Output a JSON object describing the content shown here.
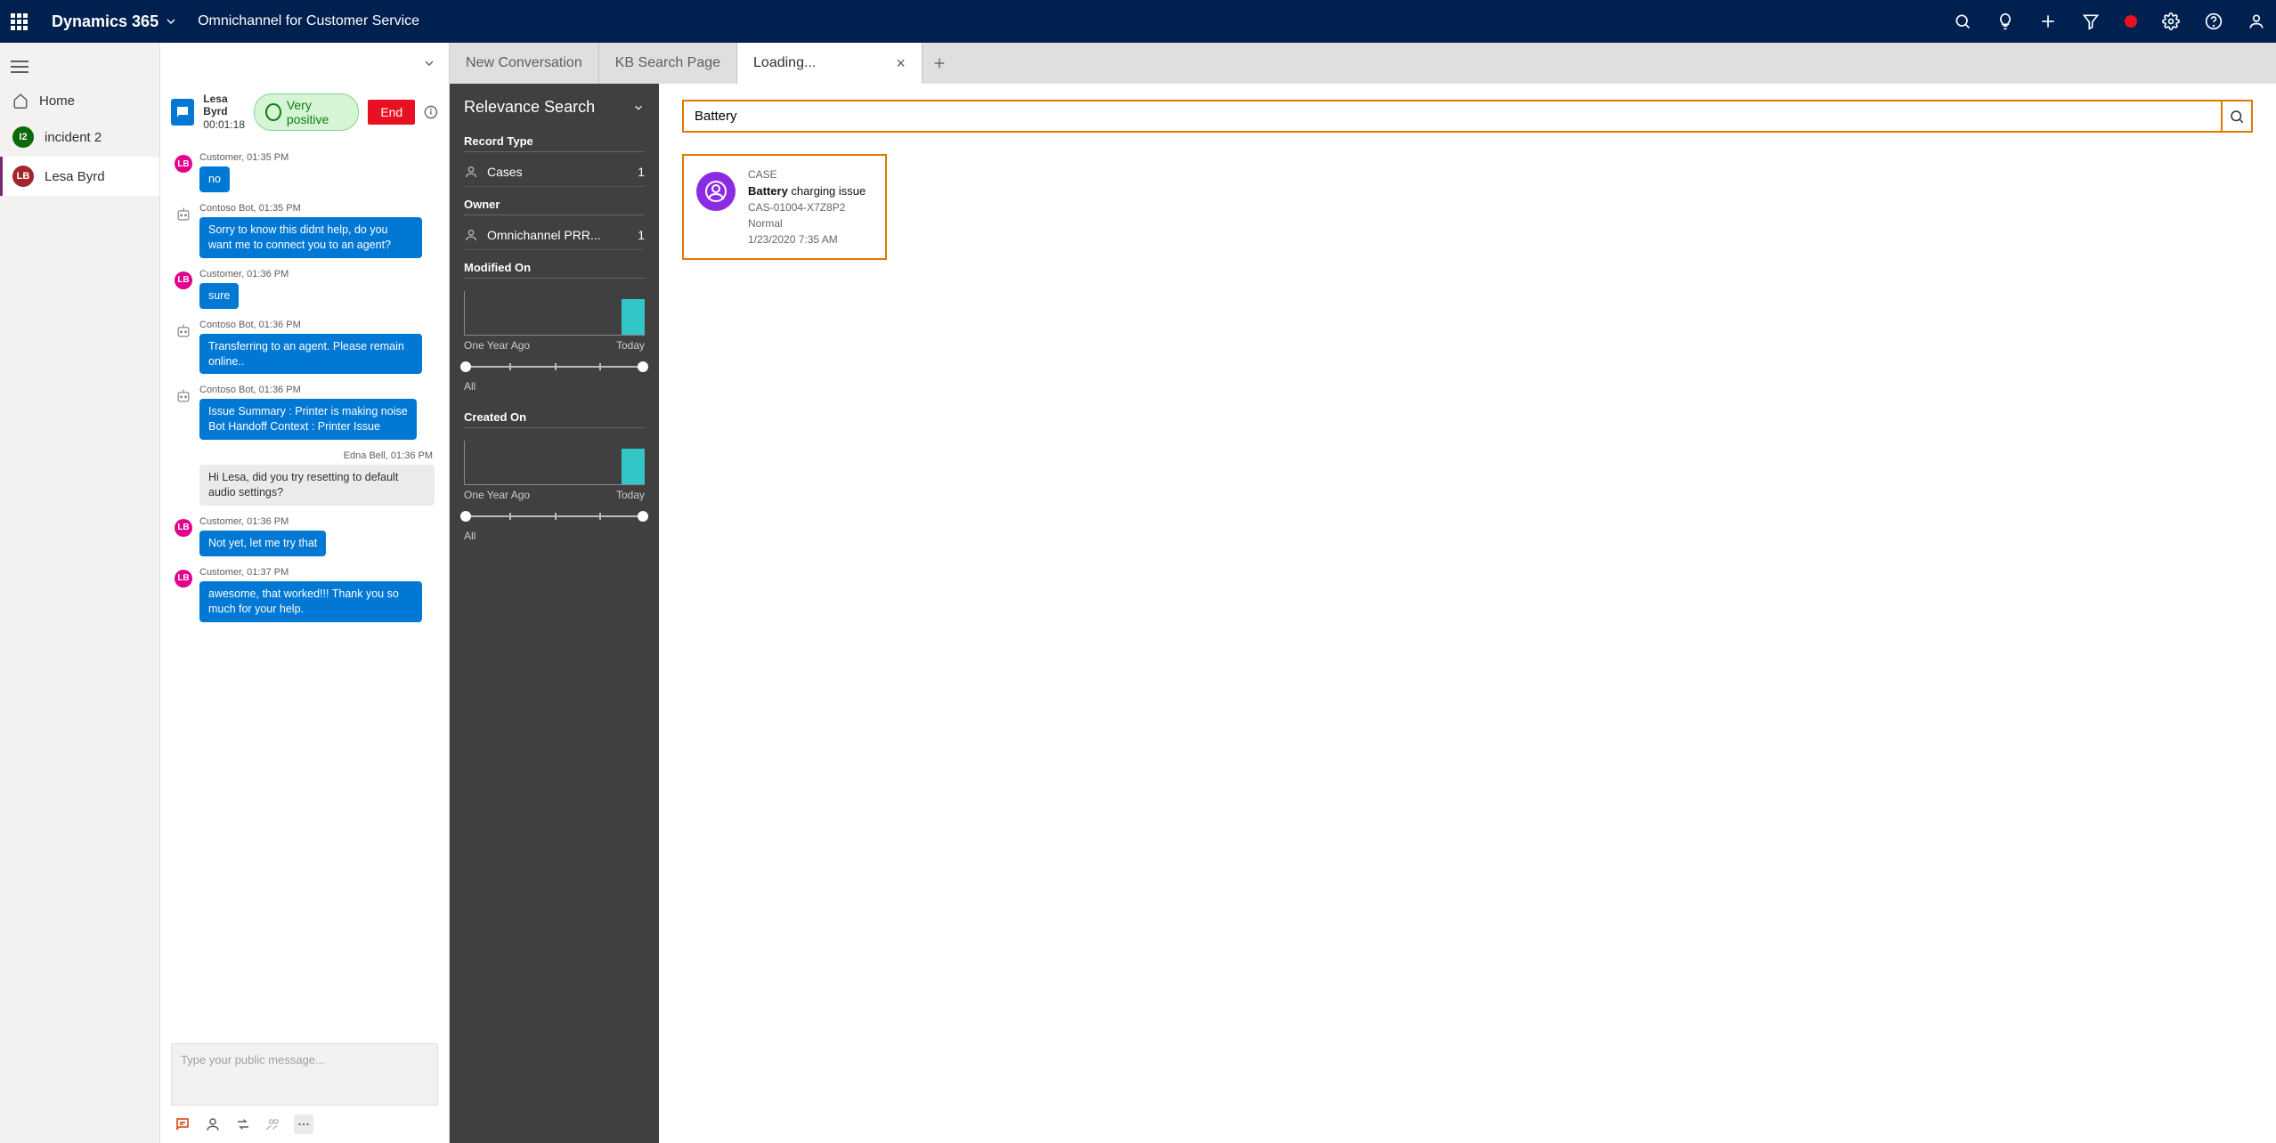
{
  "topbar": {
    "product": "Dynamics 365",
    "app": "Omnichannel for Customer Service"
  },
  "nav": {
    "home": "Home",
    "incident": {
      "badge": "I2",
      "badge_color": "#0b6a0b",
      "label": "incident 2"
    },
    "lesa": {
      "badge": "LB",
      "badge_color": "#a4262c",
      "label": "Lesa Byrd"
    }
  },
  "tabs": {
    "t1": "New Conversation",
    "t2": "KB Search Page",
    "t3": "Loading..."
  },
  "chat": {
    "person": "Lesa Byrd",
    "timer": "00:01:18",
    "sentiment": "Very positive",
    "end": "End",
    "input_placeholder": "Type your public message...",
    "messages": {
      "m1": {
        "meta": "Customer, 01:35 PM",
        "text": "no"
      },
      "m2": {
        "meta": "Contoso Bot, 01:35 PM",
        "text": "Sorry to know this didnt help, do you want me to connect you to an agent?"
      },
      "m3": {
        "meta": "Customer, 01:36 PM",
        "text": "sure"
      },
      "m4": {
        "meta": "Contoso Bot, 01:36 PM",
        "text": "Transferring to an agent. Please remain online.."
      },
      "m5": {
        "meta": "Contoso Bot, 01:36 PM",
        "text": "Issue Summary : Printer is making noise\nBot Handoff Context : Printer Issue"
      },
      "m6": {
        "meta": "Edna Bell,  01:36 PM",
        "text": "Hi Lesa, did you try resetting to default audio settings?"
      },
      "m7": {
        "meta": "Customer, 01:36 PM",
        "text": "Not yet, let me try that"
      },
      "m8": {
        "meta": "Customer, 01:37 PM",
        "text": "awesome, that worked!!! Thank you so much for your help."
      }
    }
  },
  "relevance": {
    "title": "Relevance Search",
    "record_type": "Record Type",
    "cases_label": "Cases",
    "cases_count": "1",
    "owner": "Owner",
    "owner_name": "Omnichannel PRR...",
    "owner_count": "1",
    "modified": "Modified On",
    "created": "Created On",
    "x_left": "One Year Ago",
    "x_right": "Today",
    "all": "All"
  },
  "search": {
    "value": "Battery",
    "result": {
      "type": "CASE",
      "title_bold": "Battery",
      "title_rest": " charging issue",
      "id": "CAS-01004-X7Z8P2",
      "priority": "Normal",
      "date": "1/23/2020 7:35 AM"
    }
  },
  "chart_data": [
    {
      "type": "bar",
      "title": "Modified On",
      "categories": [
        "One Year Ago",
        "",
        "",
        "",
        "",
        "",
        "Today"
      ],
      "values": [
        0,
        0,
        0,
        0,
        0,
        0,
        1
      ],
      "ylim": [
        0,
        1
      ],
      "xlabel": "",
      "ylabel": ""
    },
    {
      "type": "bar",
      "title": "Created On",
      "categories": [
        "One Year Ago",
        "",
        "",
        "",
        "",
        "",
        "Today"
      ],
      "values": [
        0,
        0,
        0,
        0,
        0,
        0,
        1
      ],
      "ylim": [
        0,
        1
      ],
      "xlabel": "",
      "ylabel": ""
    }
  ]
}
